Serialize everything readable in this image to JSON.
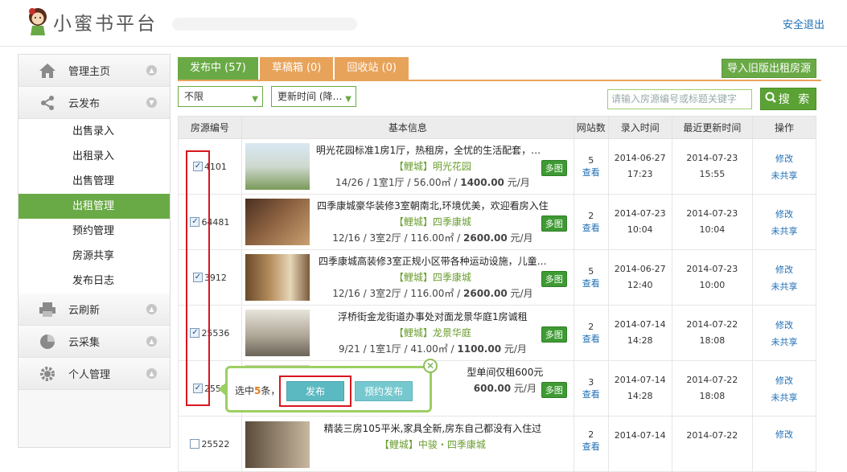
{
  "header": {
    "logo_text": "小蜜书平台",
    "logout": "安全退出"
  },
  "sidebar": {
    "groups": [
      {
        "label": "管理主页",
        "icon": "home-icon"
      },
      {
        "label": "云发布",
        "icon": "share-icon"
      }
    ],
    "sub_items": [
      {
        "label": "出售录入"
      },
      {
        "label": "出租录入"
      },
      {
        "label": "出售管理"
      },
      {
        "label": "出租管理",
        "active": true
      },
      {
        "label": "预约管理"
      },
      {
        "label": "房源共享"
      },
      {
        "label": "发布日志"
      }
    ],
    "groups_after": [
      {
        "label": "云刷新",
        "icon": "printer-icon"
      },
      {
        "label": "云采集",
        "icon": "pie-chart-icon"
      },
      {
        "label": "个人管理",
        "icon": "gear-icon"
      }
    ]
  },
  "tabs": [
    {
      "label": "发布中 (57)",
      "active": true
    },
    {
      "label": "草稿箱 (0)"
    },
    {
      "label": "回收站 (0)"
    }
  ],
  "import_button": "导入旧版出租房源",
  "filters": {
    "range": "不限",
    "sort": "更新时间 (降…"
  },
  "search": {
    "placeholder": "请输入房源编号或标题关键字",
    "button": "搜 索"
  },
  "table": {
    "headers": [
      "房源编号",
      "基本信息",
      "网站数",
      "录入时间",
      "最近更新时间",
      "操作"
    ],
    "rows": [
      {
        "id": "4101",
        "checked": true,
        "title": "明光花园标准1房1厅，热租房，全忧的生活配套，绝…",
        "tag": "【鲤城】明光花园",
        "detail_prefix": "14/26 / 1室1厅 / 56.00㎡ / ",
        "price": "1400.00",
        "unit": " 元/月",
        "sites": "5",
        "view": "查看",
        "created_date": "2014-06-27",
        "created_time": "17:23",
        "updated_date": "2014-07-23",
        "updated_time": "15:55",
        "edit": "修改",
        "share": "未共享",
        "badge": "多图"
      },
      {
        "id": "64481",
        "checked": true,
        "title": "四季康城豪华装修3室朝南北,环境优美，欢迎看房入住",
        "tag": "【鲤城】四季康城",
        "detail_prefix": "12/16 / 3室2厅 / 116.00㎡ / ",
        "price": "2600.00",
        "unit": " 元/月",
        "sites": "2",
        "view": "查看",
        "created_date": "2014-07-23",
        "created_time": "10:04",
        "updated_date": "2014-07-23",
        "updated_time": "10:04",
        "edit": "修改",
        "share": "未共享",
        "badge": "多图"
      },
      {
        "id": "3912",
        "checked": true,
        "title": "四季康城高装修3室正规小区带各种运动设施，儿童…",
        "tag": "【鲤城】四季康城",
        "detail_prefix": "12/16 / 3室2厅 / 116.00㎡ / ",
        "price": "2600.00",
        "unit": " 元/月",
        "sites": "5",
        "view": "查看",
        "created_date": "2014-06-27",
        "created_time": "12:40",
        "updated_date": "2014-07-23",
        "updated_time": "10:00",
        "edit": "修改",
        "share": "未共享",
        "badge": "多图"
      },
      {
        "id": "25536",
        "checked": true,
        "title": "浮桥街金龙街道办事处对面龙景华庭1房诚租",
        "tag": "【鲤城】龙景华庭",
        "detail_prefix": "9/21 / 1室1厅 / 41.00㎡ / ",
        "price": "1100.00",
        "unit": " 元/月",
        "sites": "2",
        "view": "查看",
        "created_date": "2014-07-14",
        "created_time": "14:28",
        "updated_date": "2014-07-22",
        "updated_time": "18:08",
        "edit": "修改",
        "share": "未共享",
        "badge": "多图"
      },
      {
        "id": "2552",
        "checked": true,
        "title": "型单间仅租600元",
        "tag": "",
        "detail_prefix": "",
        "price": "600.00",
        "unit": " 元/月",
        "sites": "3",
        "view": "查看",
        "created_date": "2014-07-14",
        "created_time": "14:28",
        "updated_date": "2014-07-22",
        "updated_time": "18:08",
        "edit": "修改",
        "share": "未共享",
        "badge": "多图"
      },
      {
        "id": "25522",
        "checked": false,
        "title": "精装三房105平米,家具全新,房东自己都没有入住过",
        "tag": "【鲤城】中骏・四季康城",
        "detail_prefix": "",
        "price": "",
        "unit": "",
        "sites": "2",
        "view": "查看",
        "created_date": "2014-07-14",
        "created_time": "",
        "updated_date": "2014-07-22",
        "updated_time": "",
        "edit": "修改",
        "share": "",
        "badge": ""
      }
    ]
  },
  "popup": {
    "text_prefix": "选中",
    "count": "5",
    "text_suffix": "条，",
    "publish": "发布",
    "schedule_publish": "预约发布"
  },
  "colors": {
    "green": "#6aaa46",
    "orange": "#e8a35a",
    "link": "#1f6fb5",
    "highlight_red": "#d7171f"
  }
}
